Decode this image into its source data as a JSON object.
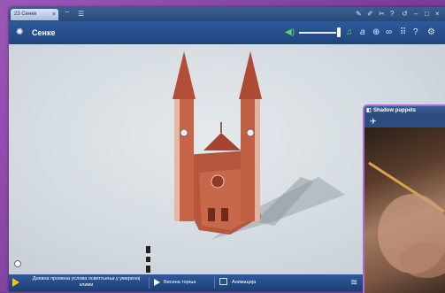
{
  "tab": {
    "label": "23 Сенке"
  },
  "header": {
    "title": "Сенке"
  },
  "bottom": {
    "daily_change": "Дневна промена услова осветљења у умереној клими",
    "tower_height": "Висина торња",
    "animation": "Анимација"
  },
  "popup": {
    "title": "Shadow puppets"
  },
  "icons": {
    "header_left": "gear-icon",
    "volume": "speaker-icon",
    "music": "music-note-icon",
    "text": "text-icon",
    "web": "globe-icon",
    "link": "link-icon",
    "grid": "grid-icon",
    "help": "question-icon",
    "settings": "settings-icon"
  },
  "colors": {
    "accent": "#2f5a9a",
    "frame": "#8a47a8",
    "play": "#f1c40f"
  }
}
